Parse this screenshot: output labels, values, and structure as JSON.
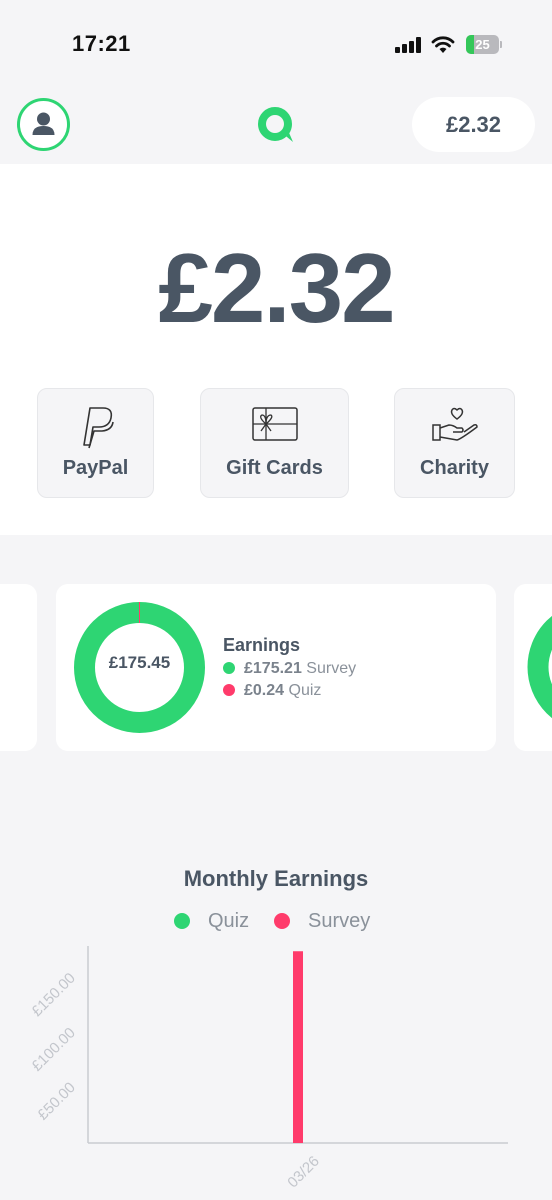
{
  "status_bar": {
    "time": "17:21",
    "battery": "25"
  },
  "header": {
    "balance": "£2.32"
  },
  "balance": {
    "amount": "£2.32"
  },
  "payout_options": [
    {
      "label": "PayPal",
      "icon": "paypal-icon"
    },
    {
      "label": "Gift Cards",
      "icon": "gift-card-icon"
    },
    {
      "label": "Charity",
      "icon": "charity-hand-heart-icon"
    }
  ],
  "earnings_card": {
    "total": "£175.45",
    "title": "Earnings",
    "rows": [
      {
        "amount": "£175.21",
        "label": "Survey",
        "color": "#2ed573"
      },
      {
        "amount": "£0.24",
        "label": "Quiz",
        "color": "#ff3b6b"
      }
    ]
  },
  "colors": {
    "green": "#2ed573",
    "pink": "#ff3b6b",
    "text": "#4a5664"
  },
  "monthly_chart": {
    "title": "Monthly Earnings",
    "legend": [
      {
        "label": "Quiz",
        "color": "#2ed573"
      },
      {
        "label": "Survey",
        "color": "#ff3b6b"
      }
    ]
  },
  "chart_data": {
    "type": "bar",
    "title": "Monthly Earnings",
    "categories": [
      "03/26"
    ],
    "series": [
      {
        "name": "Quiz",
        "values": [
          0.24
        ]
      },
      {
        "name": "Survey",
        "values": [
          175.21
        ]
      }
    ],
    "y_ticks": [
      "£50.00",
      "£100.00",
      "£150.00"
    ],
    "y_tick_values": [
      50,
      100,
      150
    ],
    "ylim": [
      0,
      180
    ],
    "grid": false,
    "legend_position": "top"
  }
}
